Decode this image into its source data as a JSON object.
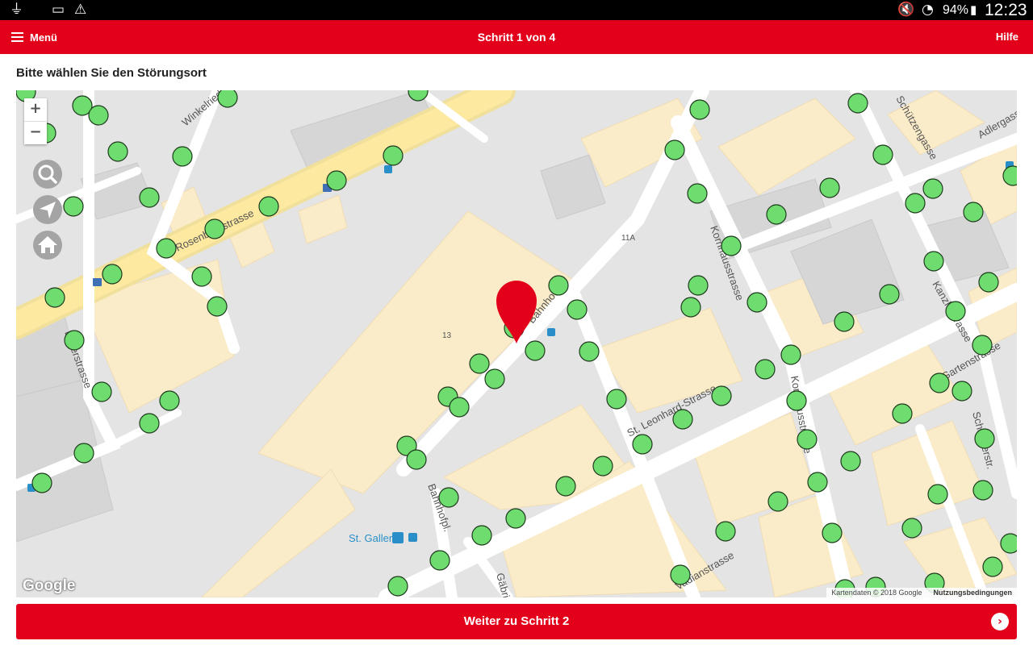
{
  "status_bar": {
    "usb_icon": "usb-icon",
    "battery_saver_icon": "battery-saver-icon",
    "warning_icon": "warning-icon",
    "mute_icon": "mute-icon",
    "wifi_icon": "wifi-icon",
    "battery_percent": "94%",
    "time": "12:23"
  },
  "header": {
    "menu_label": "Menü",
    "title": "Schritt 1 von 4",
    "help_label": "Hilfe",
    "color": "#e3001b"
  },
  "prompt": "Bitte wählen Sie den Störungsort",
  "map": {
    "zoom_in": "+",
    "zoom_out": "−",
    "controls": [
      "search-icon",
      "locate-icon",
      "home-icon"
    ],
    "provider_logo": "Google",
    "attribution": "Kartendaten © 2018 Google",
    "terms": "Nutzungsbedingungen",
    "street_labels": [
      "Winkelriedstrasse",
      "Rosenbergstrasse",
      "Bahnhofstrasse",
      "Bahnhofpl.",
      "Gäbrisstrasse",
      "St. Leonhard-Strasse",
      "Kornhausstrasse",
      "Vadianstrasse",
      "Schützengasse",
      "Adlergasse",
      "Kanzleistrasse",
      "Schreinerstrasse",
      "Gartenstrasse",
      "Lagerstrasse"
    ],
    "house_numbers": [
      "13",
      "11A"
    ],
    "poi_label": "St. Gallen",
    "marker_color": "#e3001b",
    "point_color": "#6fdc6f"
  },
  "footer": {
    "next_label": "Weiter zu Schritt 2"
  }
}
